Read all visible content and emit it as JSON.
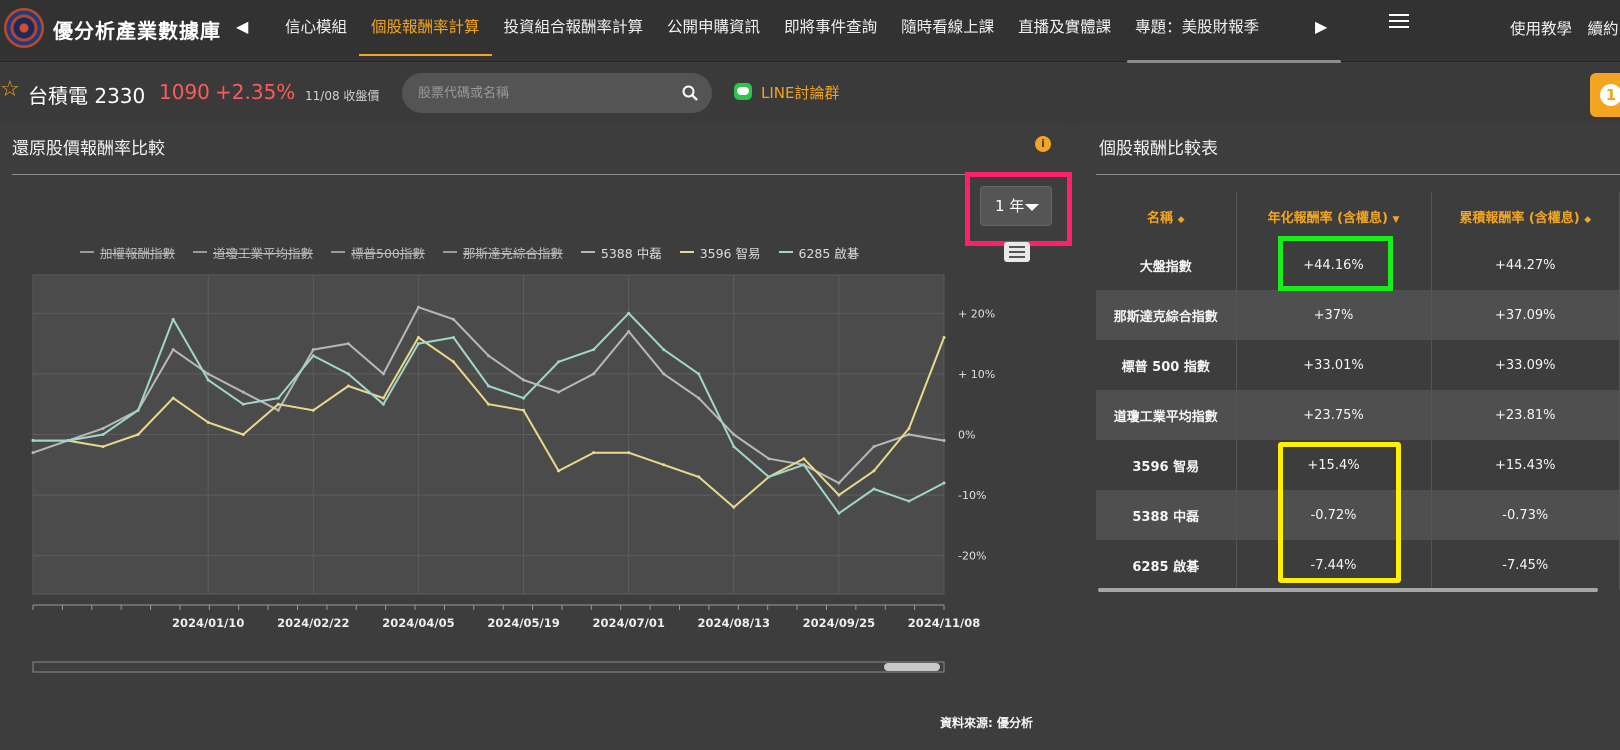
{
  "app": {
    "brand": "優分析產業數據庫",
    "nav_tabs": [
      {
        "label": "信心模組",
        "active": false
      },
      {
        "label": "個股報酬率計算",
        "active": true
      },
      {
        "label": "投資組合報酬率計算",
        "active": false
      },
      {
        "label": "公開申購資訊",
        "active": false
      },
      {
        "label": "即將事件查詢",
        "active": false
      },
      {
        "label": "隨時看線上課",
        "active": false
      },
      {
        "label": "直播及實體課",
        "active": false
      },
      {
        "label": "專題：美股財報季",
        "active": false
      }
    ],
    "right_links": "使用教學　續約",
    "orange_tab_badge": "1"
  },
  "stock": {
    "name": "台積電 2330",
    "price": "1090",
    "change": "+2.35%",
    "date_label": "11/08 收盤價"
  },
  "search": {
    "placeholder": "股票代碼或名稱"
  },
  "line_link": "LINE討論群",
  "chart_panel": {
    "title": "還原股價報酬率比較",
    "period": "1 年",
    "source": "資料來源: 優分析"
  },
  "table_panel": {
    "title": "個股報酬比較表",
    "headers": [
      "名稱",
      "年化報酬率 (含權息)",
      "累積報酬率 (含權息)"
    ],
    "rows": [
      {
        "name": "大盤指數",
        "annual": "+44.16%",
        "cumulative": "+44.27%"
      },
      {
        "name": "那斯達克綜合指數",
        "annual": "+37%",
        "cumulative": "+37.09%"
      },
      {
        "name": "標普 500 指數",
        "annual": "+33.01%",
        "cumulative": "+33.09%"
      },
      {
        "name": "道瓊工業平均指數",
        "annual": "+23.75%",
        "cumulative": "+23.81%"
      },
      {
        "name": "3596 智易",
        "annual": "+15.4%",
        "cumulative": "+15.43%"
      },
      {
        "name": "5388 中磊",
        "annual": "-0.72%",
        "cumulative": "-0.73%"
      },
      {
        "name": "6285 啟碁",
        "annual": "-7.44%",
        "cumulative": "-7.45%"
      }
    ]
  },
  "colors": {
    "accent": "#f3a521",
    "price_up": "#ff5a5a",
    "series_zhongxin": "#b8b8b8",
    "series_zhiyi": "#e9d98a",
    "series_qiji": "#9fd8c8"
  },
  "chart_data": {
    "type": "line",
    "ylabel": "",
    "y_ticks": [
      "+ 20%",
      "+ 10%",
      "0%",
      "-10%",
      "-20%"
    ],
    "ylim": [
      -20,
      20
    ],
    "x_ticks": [
      "2024/01/10",
      "2024/02/22",
      "2024/04/05",
      "2024/05/19",
      "2024/07/01",
      "2024/08/13",
      "2024/09/25",
      "2024/11/08"
    ],
    "x": [
      "2023/11/08",
      "2023/11/22",
      "2023/12/06",
      "2023/12/20",
      "2024/01/03",
      "2024/01/10",
      "2024/01/24",
      "2024/02/07",
      "2024/02/22",
      "2024/03/07",
      "2024/03/21",
      "2024/04/05",
      "2024/04/19",
      "2024/05/03",
      "2024/05/19",
      "2024/06/03",
      "2024/06/17",
      "2024/07/01",
      "2024/07/15",
      "2024/07/29",
      "2024/08/13",
      "2024/08/27",
      "2024/09/10",
      "2024/09/25",
      "2024/10/09",
      "2024/10/23",
      "2024/11/08"
    ],
    "legend": [
      "加權報酬指數",
      "道瓊工業平均指數",
      "標普500指數",
      "那斯達克綜合指數",
      "5388 中磊",
      "3596 智易",
      "6285 啟碁"
    ],
    "hidden_series": [
      "加權報酬指數",
      "道瓊工業平均指數",
      "標普500指數",
      "那斯達克綜合指數"
    ],
    "series": [
      {
        "name": "5388 中磊",
        "values": [
          -3,
          -1,
          1,
          4,
          14,
          10,
          7,
          4,
          14,
          15,
          10,
          21,
          19,
          13,
          9,
          7,
          10,
          17,
          10,
          6,
          0,
          -4,
          -5,
          -8,
          -2,
          0,
          -1
        ]
      },
      {
        "name": "3596 智易",
        "values": [
          -1,
          -1,
          -2,
          0,
          6,
          2,
          0,
          5,
          4,
          8,
          6,
          16,
          12,
          5,
          4,
          -6,
          -3,
          -3,
          -5,
          -7,
          -12,
          -7,
          -4,
          -10,
          -6,
          1,
          16
        ]
      },
      {
        "name": "6285 啟碁",
        "values": [
          -1,
          -1,
          0,
          4,
          19,
          9,
          5,
          6,
          13,
          10,
          5,
          15,
          16,
          8,
          6,
          12,
          14,
          20,
          14,
          10,
          -2,
          -7,
          -5,
          -13,
          -9,
          -11,
          -8
        ]
      }
    ]
  }
}
